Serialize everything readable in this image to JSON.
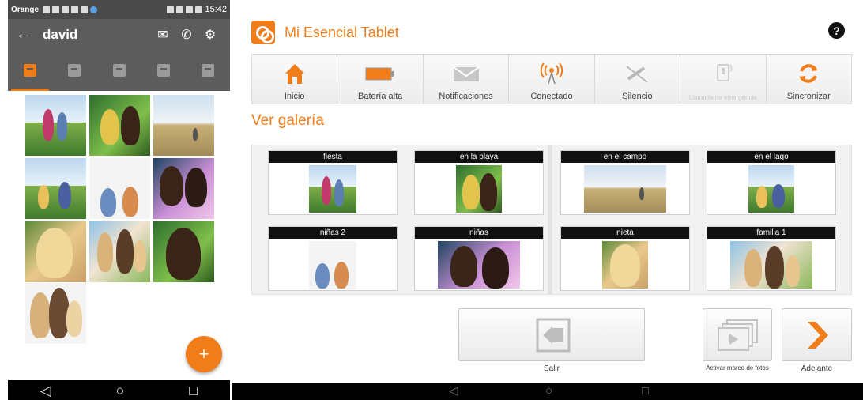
{
  "phone": {
    "status": {
      "carrier": "Orange",
      "time": "15:42"
    },
    "appbar": {
      "back": "←",
      "title": "david",
      "mail_icon": "✉",
      "phone_icon": "✆",
      "settings_icon": "⚙"
    },
    "tabs": [
      "gallery-tab",
      "contacts-tab",
      "add-tab",
      "calendar-tab",
      "folder-tab"
    ],
    "fab_label": "+",
    "nav": {
      "back": "◁",
      "home": "○",
      "recent": "□"
    }
  },
  "tablet": {
    "title": "Mi Esencial Tablet",
    "help_label": "?",
    "toolbar": [
      {
        "label": "Inicio",
        "icon": "home-icon"
      },
      {
        "label": "Batería alta",
        "icon": "battery-icon"
      },
      {
        "label": "Notificaciones",
        "icon": "envelope-icon"
      },
      {
        "label": "Conectado",
        "icon": "antenna-icon"
      },
      {
        "label": "Silencio",
        "icon": "mute-icon"
      },
      {
        "label": "Llamada de emergencia",
        "icon": "emergency-call-icon",
        "disabled": true
      },
      {
        "label": "Sincronizar",
        "icon": "sync-icon"
      }
    ],
    "section_title": "Ver galería",
    "albums": [
      {
        "caption": "fiesta"
      },
      {
        "caption": "en la playa"
      },
      {
        "caption": "en el campo"
      },
      {
        "caption": "en el lago"
      },
      {
        "caption": "niñas 2"
      },
      {
        "caption": "niñas"
      },
      {
        "caption": "nieta"
      },
      {
        "caption": "familia 1"
      }
    ],
    "buttons": {
      "salir": "Salir",
      "marco": "Activar marco de fotos",
      "adelante": "Adelante"
    },
    "nav": {
      "back": "◁",
      "home": "○",
      "recent": "□"
    },
    "colors": {
      "accent": "#f07d1a",
      "caption_bg": "#111111"
    }
  }
}
